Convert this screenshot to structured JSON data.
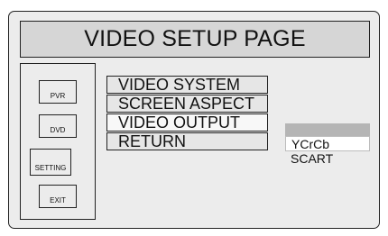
{
  "header": {
    "title": "VIDEO SETUP PAGE"
  },
  "sidebar": {
    "buttons": [
      {
        "label": "PVR"
      },
      {
        "label": "DVD"
      },
      {
        "label": "SETTING"
      },
      {
        "label": "EXIT"
      }
    ]
  },
  "menu": {
    "items": [
      {
        "label": "VIDEO SYSTEM"
      },
      {
        "label": "SCREEN ASPECT"
      },
      {
        "label": "VIDEO OUTPUT"
      },
      {
        "label": "RETURN"
      }
    ],
    "selected": "VIDEO OUTPUT"
  },
  "options": {
    "items": [
      {
        "label": "YCrCb"
      },
      {
        "label": "SCART"
      }
    ],
    "highlighted": "YCrCb"
  }
}
